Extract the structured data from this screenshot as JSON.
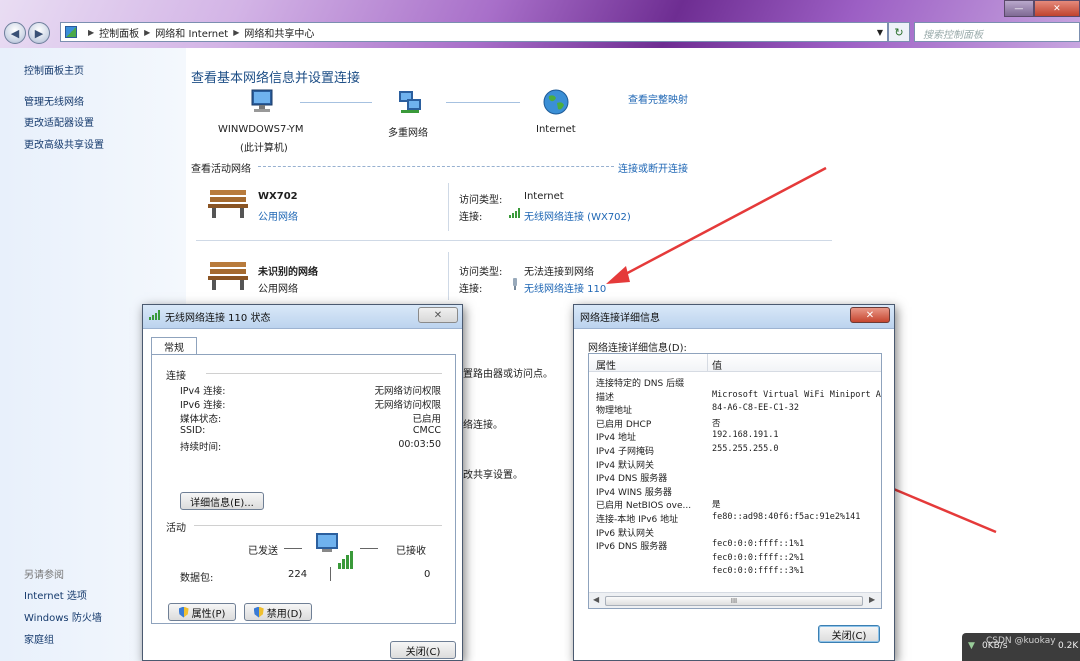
{
  "window": {
    "minimize": "—",
    "close": "✕"
  },
  "breadcrumb": [
    "控制面板",
    "网络和 Internet",
    "网络和共享中心"
  ],
  "search_placeholder": "搜索控制面板",
  "sidebar": {
    "home": "控制面板主页",
    "items": [
      "管理无线网络",
      "更改适配器设置",
      "更改高级共享设置"
    ],
    "see_also_label": "另请参阅",
    "see_also": [
      "Internet 选项",
      "Windows 防火墙",
      "家庭组"
    ]
  },
  "main": {
    "title": "查看基本网络信息并设置连接",
    "view_full_map": "查看完整映射",
    "map": {
      "pc": "WINWDOWS7-YM",
      "pc_sub": "(此计算机)",
      "middle": "多重网络",
      "internet": "Internet"
    },
    "active_networks_label": "查看活动网络",
    "connect_disconnect": "连接或断开连接",
    "networks": [
      {
        "name": "WX702",
        "type": "公用网络",
        "access_label": "访问类型:",
        "access": "Internet",
        "conn_label": "连接:",
        "conn": "无线网络连接 (WX702)"
      },
      {
        "name": "未识别的网络",
        "type": "公用网络",
        "access_label": "访问类型:",
        "access": "无法连接到网络",
        "conn_label": "连接:",
        "conn": "无线网络连接 110"
      }
    ],
    "partial": [
      "置路由器或访问点。",
      "络连接。",
      "改共享设置。"
    ]
  },
  "status_dialog": {
    "title": "无线网络连接 110 状态",
    "close_x": "✕",
    "tab": "常规",
    "connection_label": "连接",
    "rows": [
      {
        "k": "IPv4 连接:",
        "v": "无网络访问权限"
      },
      {
        "k": "IPv6 连接:",
        "v": "无网络访问权限"
      },
      {
        "k": "媒体状态:",
        "v": "已启用"
      },
      {
        "k": "SSID:",
        "v": "CMCC"
      },
      {
        "k": "持续时间:",
        "v": "00:03:50"
      }
    ],
    "details_button": "详细信息(E)...",
    "activity_label": "活动",
    "sent": "已发送",
    "received": "已接收",
    "packets_label": "数据包:",
    "packets_sent": "224",
    "packets_received": "0",
    "properties_button": "属性(P)",
    "disable_button": "禁用(D)",
    "close_button": "关闭(C)"
  },
  "details_dialog": {
    "title": "网络连接详细信息",
    "close_x": "✕",
    "label": "网络连接详细信息(D):",
    "col_property": "属性",
    "col_value": "值",
    "rows": [
      {
        "k": "连接特定的 DNS 后缀",
        "v": ""
      },
      {
        "k": "描述",
        "v": "Microsoft Virtual WiFi Miniport A"
      },
      {
        "k": "物理地址",
        "v": "84-A6-C8-EE-C1-32"
      },
      {
        "k": "已启用 DHCP",
        "v": "否"
      },
      {
        "k": "IPv4 地址",
        "v": "192.168.191.1"
      },
      {
        "k": "IPv4 子网掩码",
        "v": "255.255.255.0"
      },
      {
        "k": "IPv4 默认网关",
        "v": ""
      },
      {
        "k": "IPv4 DNS 服务器",
        "v": ""
      },
      {
        "k": "IPv4 WINS 服务器",
        "v": ""
      },
      {
        "k": "已启用 NetBIOS ove...",
        "v": "是"
      },
      {
        "k": "连接-本地 IPv6 地址",
        "v": "fe80::ad98:40f6:f5ac:91e2%141"
      },
      {
        "k": "IPv6 默认网关",
        "v": ""
      },
      {
        "k": "IPv6 DNS 服务器",
        "v": "fec0:0:0:ffff::1%1"
      },
      {
        "k": "",
        "v": "fec0:0:0:ffff::2%1"
      },
      {
        "k": "",
        "v": "fec0:0:0:ffff::3%1"
      }
    ],
    "scroll_mid": "III",
    "close_button": "关闭(C)"
  },
  "tray": {
    "speed": "0KB/s",
    "watermark": "CSDN @kuokay",
    "speed2": "0.2K"
  }
}
